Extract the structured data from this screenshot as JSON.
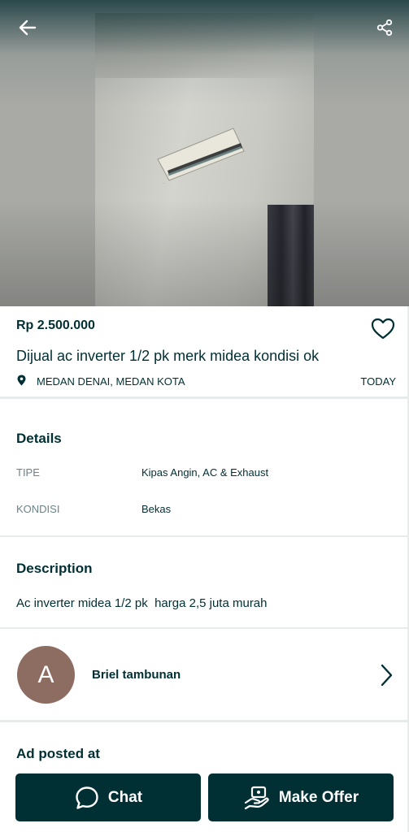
{
  "header": {
    "back_icon": "arrow-left-icon",
    "share_icon": "share-icon"
  },
  "listing": {
    "price": "Rp 2.500.000",
    "title": "Dijual ac inverter 1/2 pk merk midea kondisi ok",
    "location": "MEDAN DENAI, MEDAN KOTA",
    "date": "TODAY",
    "favorite_icon": "heart-outline-icon"
  },
  "details": {
    "title": "Details",
    "rows": [
      {
        "key": "TIPE",
        "value": "Kipas Angin, AC & Exhaust"
      },
      {
        "key": "KONDISI",
        "value": "Bekas"
      }
    ]
  },
  "description": {
    "title": "Description",
    "text": "Ac inverter midea 1/2 pk  harga 2,5 juta murah"
  },
  "seller": {
    "initial": "A",
    "name": "Briel tambunan",
    "avatar_color": "#8d6c61"
  },
  "ad_posted": {
    "title": "Ad posted at"
  },
  "actions": {
    "chat_label": "Chat",
    "offer_label": "Make Offer",
    "button_color": "#002f34"
  }
}
